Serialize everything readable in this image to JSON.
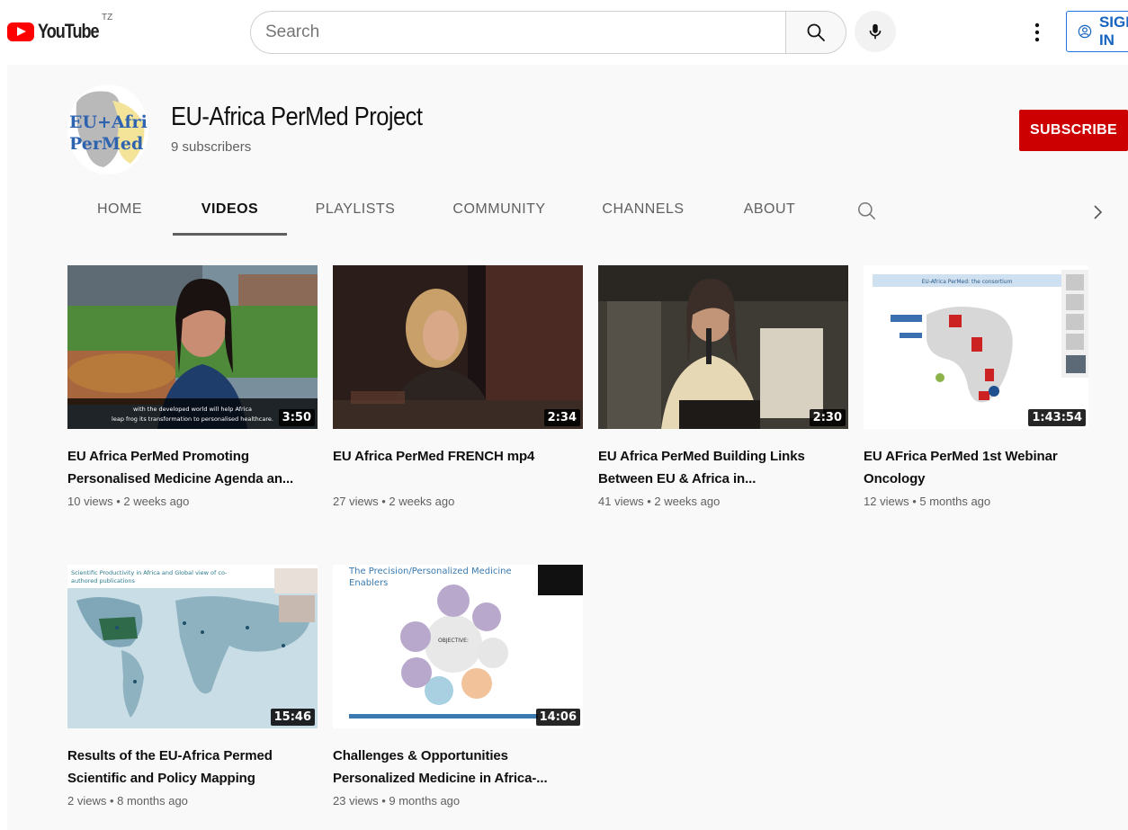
{
  "masthead": {
    "logo_text": "YouTube",
    "country_code": "TZ",
    "search_placeholder": "Search",
    "signin_label": "SIGN IN"
  },
  "channel": {
    "avatar_text_line1": "EU+Afric",
    "avatar_text_line2": "PerMed",
    "name": "EU-Africa PerMed Project",
    "subscribers": "9 subscribers",
    "subscribe_label": "SUBSCRIBE"
  },
  "tabs": [
    {
      "label": "HOME",
      "active": false
    },
    {
      "label": "VIDEOS",
      "active": true
    },
    {
      "label": "PLAYLISTS",
      "active": false
    },
    {
      "label": "COMMUNITY",
      "active": false
    },
    {
      "label": "CHANNELS",
      "active": false
    },
    {
      "label": "ABOUT",
      "active": false
    }
  ],
  "videos": [
    {
      "title_line1": "EU Africa PerMed Promoting",
      "title_line2": "Personalised Medicine Agenda an...",
      "meta": "10 views • 2 weeks ago",
      "duration": "3:50",
      "caption_line1": "with the developed world will help Africa",
      "caption_line2": "leap frog its transformation to personalised healthcare."
    },
    {
      "title_line1": "EU Africa PerMed FRENCH mp4",
      "title_line2": "",
      "meta": "27 views • 2 weeks ago",
      "duration": "2:34"
    },
    {
      "title_line1": "EU Africa PerMed Building Links",
      "title_line2": "Between EU & Africa in...",
      "meta": "41 views • 2 weeks ago",
      "duration": "2:30"
    },
    {
      "title_line1": "EU AFrica PerMed 1st Webinar",
      "title_line2": "Oncology",
      "meta": "12 views • 5 months ago",
      "duration": "1:43:54",
      "slide_heading": "EU-Africa PerMed: the consortium"
    },
    {
      "title_line1": "Results of the EU-Africa Permed",
      "title_line2": "Scientific and Policy Mapping",
      "meta": "2 views • 8 months ago",
      "duration": "15:46",
      "slide_heading_line1": "Scientific Productivity in Africa and Global view of co-",
      "slide_heading_line2": "authored publications"
    },
    {
      "title_line1": "Challenges & Opportunities",
      "title_line2": "Personalized Medicine in Africa-...",
      "meta": "23 views • 9 months ago",
      "duration": "14:06",
      "slide_heading_line1": "The Precision/Personalized Medicine",
      "slide_heading_line2": "Enablers",
      "slide_center_text": "OBJECTIVE:"
    }
  ]
}
